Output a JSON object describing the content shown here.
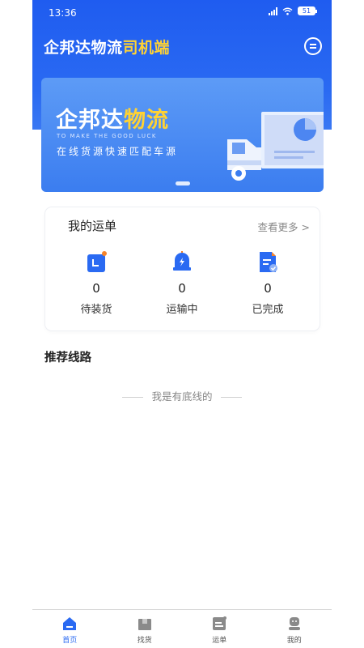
{
  "status": {
    "time": "13:36",
    "battery": "51"
  },
  "header": {
    "title_main": "企邦达物流",
    "title_accent": "司机端"
  },
  "banner": {
    "title_main": "企邦达",
    "title_accent": "物流",
    "subtitle": "TO MAKE THE GOOD LUCK",
    "description": "在线货源快速匹配车源"
  },
  "orders": {
    "title": "我的运单",
    "see_more": "查看更多 >",
    "items": [
      {
        "count": "0",
        "label": "待装货",
        "icon": "pending-load-icon"
      },
      {
        "count": "0",
        "label": "运输中",
        "icon": "in-transit-bell-icon"
      },
      {
        "count": "0",
        "label": "已完成",
        "icon": "completed-doc-icon"
      }
    ]
  },
  "routes": {
    "title": "推荐线路",
    "end_text": "我是有底线的"
  },
  "tabbar": {
    "items": [
      {
        "label": "首页",
        "icon": "home-icon",
        "active": true
      },
      {
        "label": "找货",
        "icon": "find-goods-icon",
        "active": false
      },
      {
        "label": "运单",
        "icon": "waybill-icon",
        "active": false
      },
      {
        "label": "我的",
        "icon": "profile-icon",
        "active": false
      }
    ]
  },
  "colors": {
    "primary": "#2a6af2",
    "accent": "#ffd233",
    "orange": "#f5832a"
  }
}
